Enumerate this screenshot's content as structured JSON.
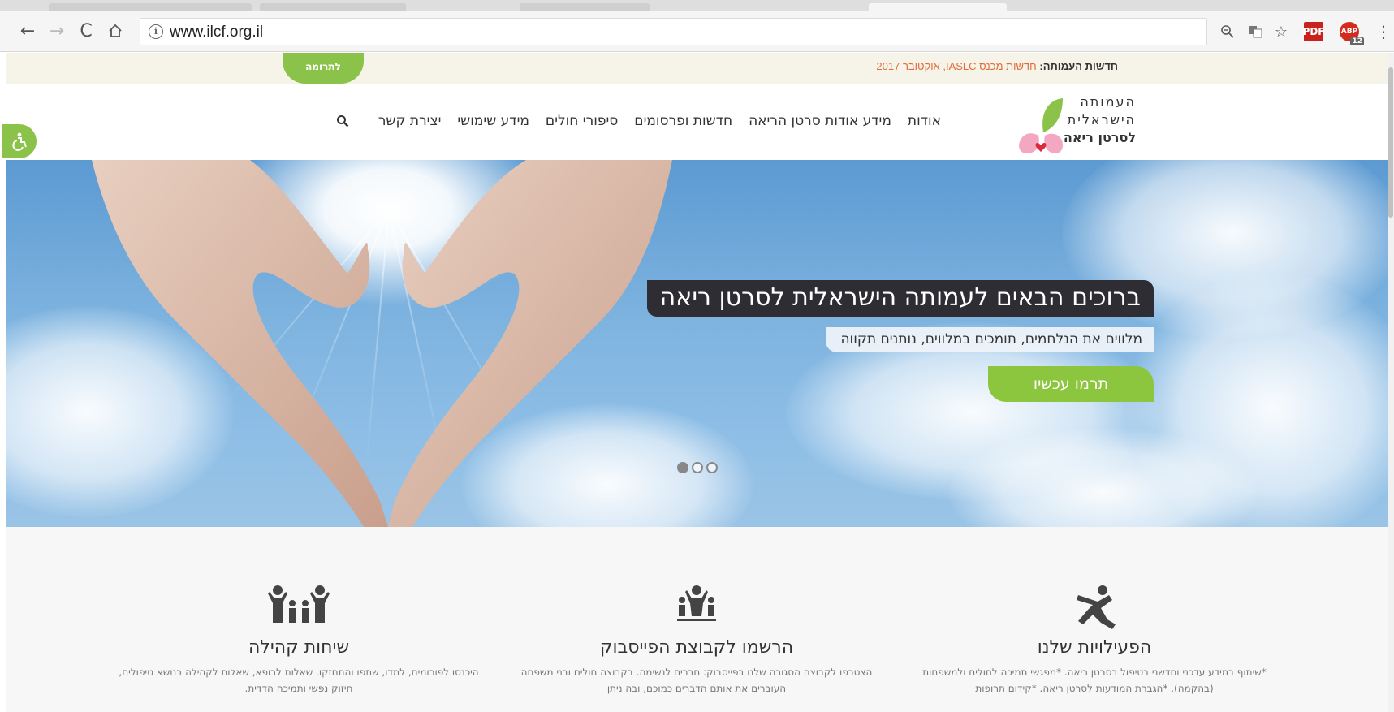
{
  "browser": {
    "url": "www.ilcf.org.il",
    "abp_count": "12",
    "pdf_label": "PDF",
    "abp_label": "ABP"
  },
  "news": {
    "label": "חדשות העמותה:",
    "text": "חדשות מכנס IASLC, אוקטובר 2017",
    "donate_tab": "לתרומה"
  },
  "logo": {
    "line1": "העמותה",
    "line2": "הישראלית",
    "line3": "לסרטן ריאה"
  },
  "nav": {
    "items": [
      {
        "label": "אודות"
      },
      {
        "label": "מידע אודות סרטן הריאה"
      },
      {
        "label": "חדשות ופרסומים"
      },
      {
        "label": "סיפורי חולים"
      },
      {
        "label": "מידע שימושי"
      },
      {
        "label": "יצירת קשר"
      }
    ]
  },
  "hero": {
    "title": "ברוכים הבאים לעמותה הישראלית לסרטן ריאה",
    "subtitle": "מלווים את הנלחמים, תומכים במלווים, נותנים תקווה",
    "cta": "תרמו עכשיו"
  },
  "features": [
    {
      "title": "הפעילויות שלנו",
      "text": "*שיתוף במידע עדכני וחדשני בטיפול בסרטן ריאה. *מפגשי תמיכה לחולים ולמשפחות (בהקמה). *הגברת המודעות לסרטן ריאה. *קידום תרופות"
    },
    {
      "title": "הרשמו לקבוצת הפייסבוק",
      "text": "הצטרפו לקבוצה הסגורה שלנו בפייסבוק: חברים לנשימה. בקבוצה חולים ובני משפחה העוברים את אותם הדברים כמוכם, ובה ניתן"
    },
    {
      "title": "שיחות קהילה",
      "text": "היכנסו לפורומים, למדו, שתפו והתחזקו. שאלות לרופא, שאלות לקהילה בנושא טיפולים, חיזוק נפשי ותמיכה הדדית."
    }
  ],
  "colors": {
    "accent_green": "#8cc63e",
    "title_bg": "#2d2d33",
    "news_orange": "#e06c3a"
  }
}
